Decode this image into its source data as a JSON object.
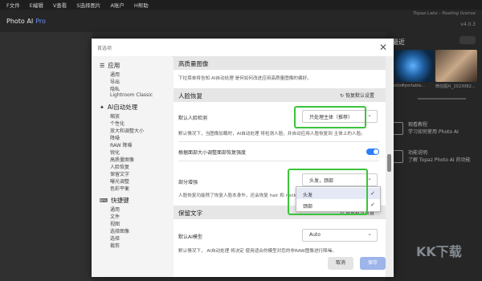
{
  "menubar": [
    "F文件",
    "E编辑",
    "V查看",
    "S选择图片",
    "A账户",
    "H帮助"
  ],
  "app": {
    "name": "Photo AI",
    "tier": "Pro",
    "license": "Topaz Labs - floating license",
    "version": "v4.0.3"
  },
  "right_panel": {
    "title": "最近",
    "thumbs": [
      "hoto#portable...",
      "微信图片_2023082..."
    ],
    "items": [
      {
        "title": "观看教程",
        "text": "学习如何使用 Photo AI"
      },
      {
        "title": "功能说明",
        "text": "了解 Topaz Photo AI 的功能"
      }
    ]
  },
  "dialog": {
    "title": "首选项",
    "close": "✕"
  },
  "nav": {
    "sections": [
      {
        "title": "应用",
        "icon": "☰",
        "items": [
          "通用",
          "导出",
          "隐私",
          "Lightroom Classic"
        ]
      },
      {
        "title": "AI自动处理",
        "icon": "✦",
        "items": [
          "缩放",
          "个性化",
          "放大和调整大小",
          "降噪",
          "RAW 降噪",
          "锐化",
          "高质量图像",
          "人脸恢复",
          "保留文字",
          "曝光调整",
          "色彩平衡"
        ]
      },
      {
        "title": "快捷键",
        "icon": "⌨",
        "items": [
          "通用",
          "文件",
          "视图",
          "选择图像",
          "选择",
          "裁剪"
        ]
      }
    ]
  },
  "content": {
    "hq": {
      "title": "高质量图像",
      "desc": "下拉菜单将告知 AI自动处理 是何如何改进应用高质量图像的偏好。"
    },
    "face": {
      "title": "人脸恢复",
      "restore_defaults": "恢复默认设置",
      "detect_label": "默认人脸检测",
      "detect_value": "只处理主体（推荐）",
      "detect_desc": "默认情况下，当图像加载时，AI自动处理 将检测人脸，并自动应用人脸恢复到 主体上的人脸。",
      "adjust_label": "根据面部大小调整面部恢复强度",
      "adjust_on": true,
      "part_label": "部分增强",
      "part_value": "头发，颈部",
      "part_desc": "人脸恢复功能除了恢复人脸本身外，还会恢复 hair 和 necks。",
      "options": [
        {
          "label": "头发",
          "checked": true
        },
        {
          "label": "颈部",
          "checked": true
        }
      ],
      "check": "✓"
    },
    "text": {
      "title": "保留文字",
      "restore_defaults": "恢复默认设置",
      "model_label": "默认AI模型",
      "model_value": "Auto",
      "model_desc": "默认情况下， AI自动处理 将决定 使用适合的模型对您的非RAW图像进行降噪。"
    }
  },
  "footer": {
    "cancel": "取消",
    "save": "保存"
  },
  "watermark": "KK下载",
  "colors": {
    "accent": "#2d7ff9",
    "highlight": "#3bc43b"
  }
}
